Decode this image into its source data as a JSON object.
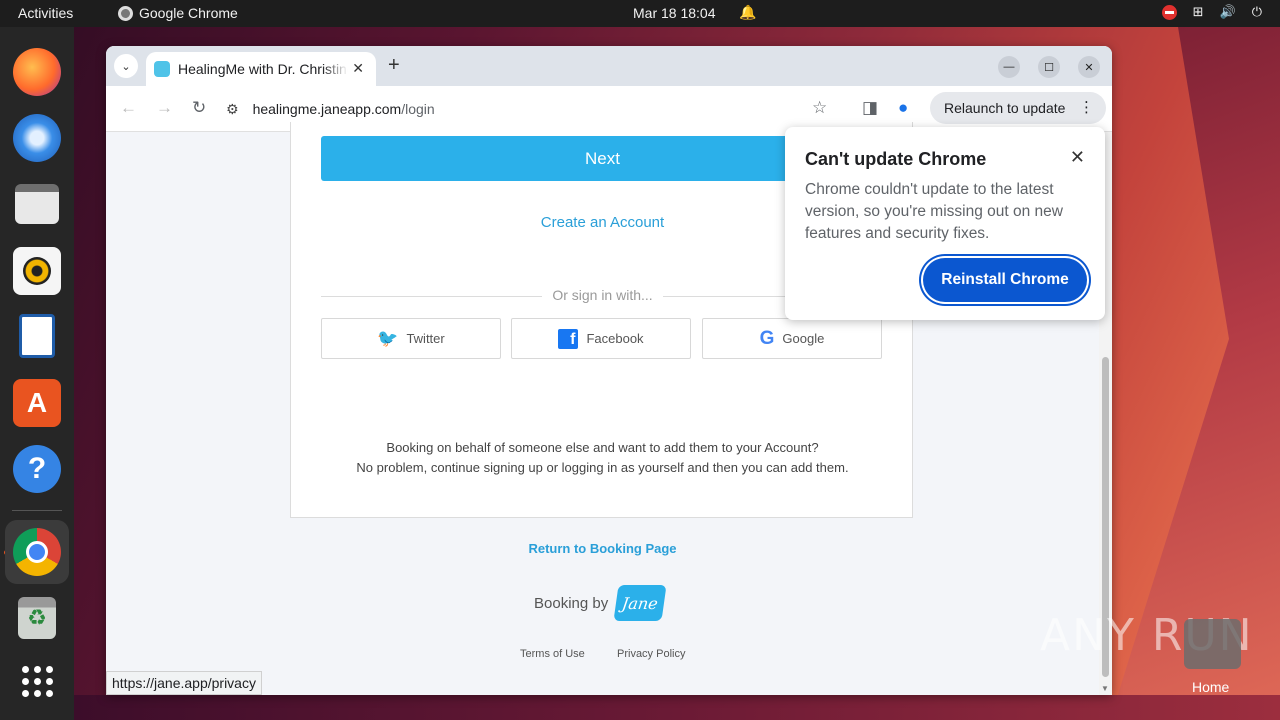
{
  "topbar": {
    "activities": "Activities",
    "app_name": "Google Chrome",
    "clock": "Mar 18  18:04"
  },
  "browser": {
    "tab_title": "HealingMe with Dr. Christine",
    "url_host": "healingme.janeapp.com",
    "url_path": "/login",
    "relaunch_label": "Relaunch to update",
    "status_url": "https://jane.app/privacy"
  },
  "page": {
    "next_label": "Next",
    "create_account": "Create an Account",
    "or_sign_in": "Or sign in with...",
    "social": {
      "twitter": "Twitter",
      "facebook": "Facebook",
      "google": "Google"
    },
    "note_line1": "Booking on behalf of someone else and want to add them to your Account?",
    "note_line2": "No problem, continue signing up or logging in as yourself and then you can add them.",
    "return_link": "Return to Booking Page",
    "booking_by": "Booking by",
    "jane_logo": "Jane",
    "terms": "Terms of Use",
    "privacy": "Privacy Policy"
  },
  "popup": {
    "title": "Can't update Chrome",
    "body": "Chrome couldn't update to the latest version, so you're missing out on new features and security fixes.",
    "button": "Reinstall Chrome"
  },
  "desktop": {
    "watermark": "ANY RUN",
    "home_label": "Home"
  },
  "colors": {
    "accent_blue": "#2bb0ea",
    "link_blue": "#2a9fd8",
    "chrome_button_blue": "#0b57d0"
  }
}
